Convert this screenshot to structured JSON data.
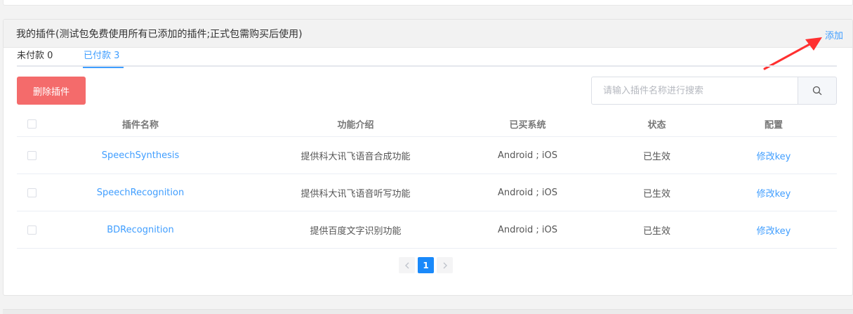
{
  "panel": {
    "title": "我的插件(测试包免费使用所有已添加的插件;正式包需购买后使用)",
    "add_label": "添加"
  },
  "tabs": [
    {
      "label": "未付款 0",
      "active": false
    },
    {
      "label": "已付款 3",
      "active": true
    }
  ],
  "toolbar": {
    "delete_label": "删除插件",
    "search_placeholder": "请输入插件名称进行搜索",
    "search_icon": "search-icon"
  },
  "table": {
    "columns": [
      "插件名称",
      "功能介绍",
      "已买系统",
      "状态",
      "配置"
    ],
    "rows": [
      {
        "name": "SpeechSynthesis",
        "desc": "提供科大讯飞语音合成功能",
        "systems": "Android ; iOS",
        "status": "已生效",
        "action": "修改key"
      },
      {
        "name": "SpeechRecognition",
        "desc": "提供科大讯飞语音听写功能",
        "systems": "Android ; iOS",
        "status": "已生效",
        "action": "修改key"
      },
      {
        "name": "BDRecognition",
        "desc": "提供百度文字识别功能",
        "systems": "Android ; iOS",
        "status": "已生效",
        "action": "修改key"
      }
    ]
  },
  "pagination": {
    "prev_icon": "chevron-left-icon",
    "current_page": "1",
    "next_icon": "chevron-right-icon"
  },
  "colors": {
    "accent": "#409eff",
    "danger_button": "#f46b6b",
    "annotation_arrow": "#ff3030"
  }
}
